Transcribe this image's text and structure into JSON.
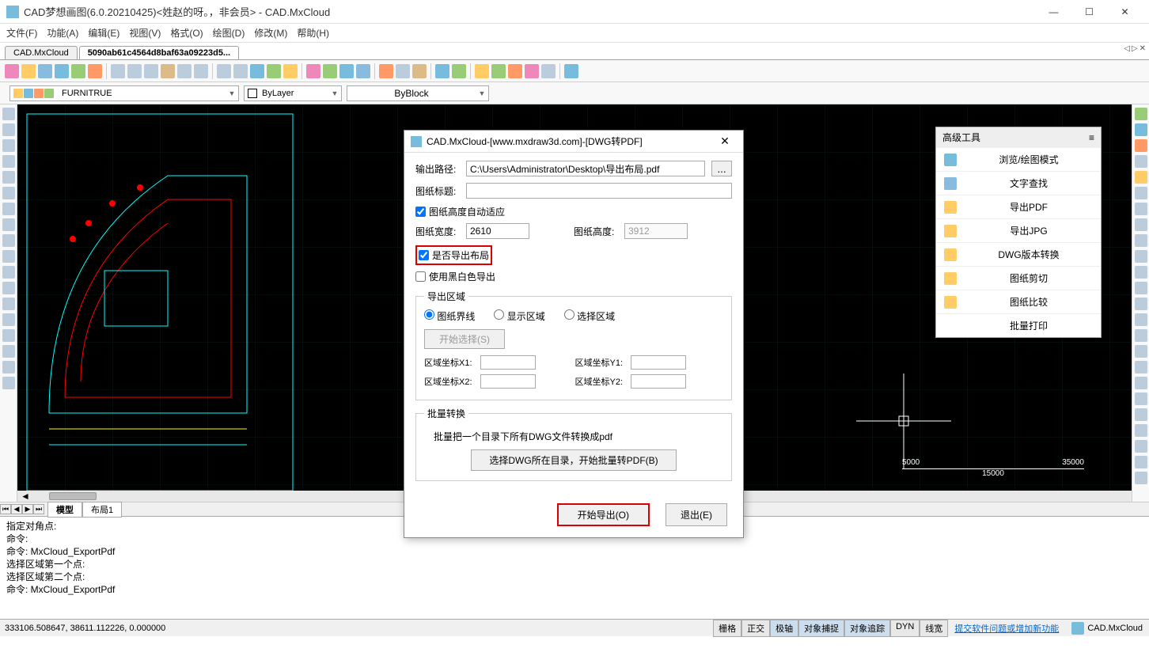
{
  "window": {
    "title": "CAD梦想画图(6.0.20210425)<姓赵的呀。，非会员> - CAD.MxCloud",
    "brand": "CAD.MxCloud"
  },
  "menubar": [
    "文件(F)",
    "功能(A)",
    "编辑(E)",
    "视图(V)",
    "格式(O)",
    "绘图(D)",
    "修改(M)",
    "帮助(H)"
  ],
  "tabs": {
    "items": [
      "CAD.MxCloud",
      "5090ab61c4564d8baf63a09223d5..."
    ],
    "active_index": 1
  },
  "layer_bar": {
    "layer": "FURNITRUE",
    "color": "ByLayer",
    "linetype": "ByBlock"
  },
  "side_panel": {
    "header": "高级工具",
    "items": [
      {
        "label": "浏览/绘图模式"
      },
      {
        "label": "文字查找"
      },
      {
        "label": "导出PDF"
      },
      {
        "label": "导出JPG"
      },
      {
        "label": "DWG版本转换"
      },
      {
        "label": "图纸剪切"
      },
      {
        "label": "图纸比较"
      },
      {
        "label": "批量打印"
      }
    ]
  },
  "ruler": {
    "a": "5000",
    "b": "15000",
    "c": "35000"
  },
  "sheet_tabs": {
    "items": [
      "模型",
      "布局1"
    ],
    "active_index": 0
  },
  "command_log": [
    "指定对角点:",
    "命令:",
    "命令: MxCloud_ExportPdf",
    "",
    "选择区域第一个点:",
    "选择区域第二个点:",
    "命令: MxCloud_ExportPdf"
  ],
  "statusbar": {
    "coords": "333106.508647,  38611.112226,  0.000000",
    "toggles": [
      "栅格",
      "正交",
      "极轴",
      "对象捕捉",
      "对象追踪",
      "DYN",
      "线宽"
    ],
    "link": "提交软件问题或增加新功能"
  },
  "dialog": {
    "title": "CAD.MxCloud-[www.mxdraw3d.com]-[DWG转PDF]",
    "output_path_label": "输出路径:",
    "output_path": "C:\\Users\\Administrator\\Desktop\\导出布局.pdf",
    "title_label": "图纸标题:",
    "title_value": "",
    "auto_height": "图纸高度自动适应",
    "width_label": "图纸宽度:",
    "width_value": "2610",
    "height_label": "图纸高度:",
    "height_value": "3912",
    "export_layout": "是否导出布局",
    "use_bw": "使用黑白色导出",
    "area_group": "导出区域",
    "radio1": "图纸界线",
    "radio2": "显示区域",
    "radio3": "选择区域",
    "start_select": "开始选择(S)",
    "x1": "区域坐标X1:",
    "y1": "区域坐标Y1:",
    "x2": "区域坐标X2:",
    "y2": "区域坐标Y2:",
    "batch_group": "批量转换",
    "batch_desc": "批量把一个目录下所有DWG文件转换成pdf",
    "batch_btn": "选择DWG所在目录，开始批量转PDF(B)",
    "ok": "开始导出(O)",
    "cancel": "退出(E)"
  }
}
